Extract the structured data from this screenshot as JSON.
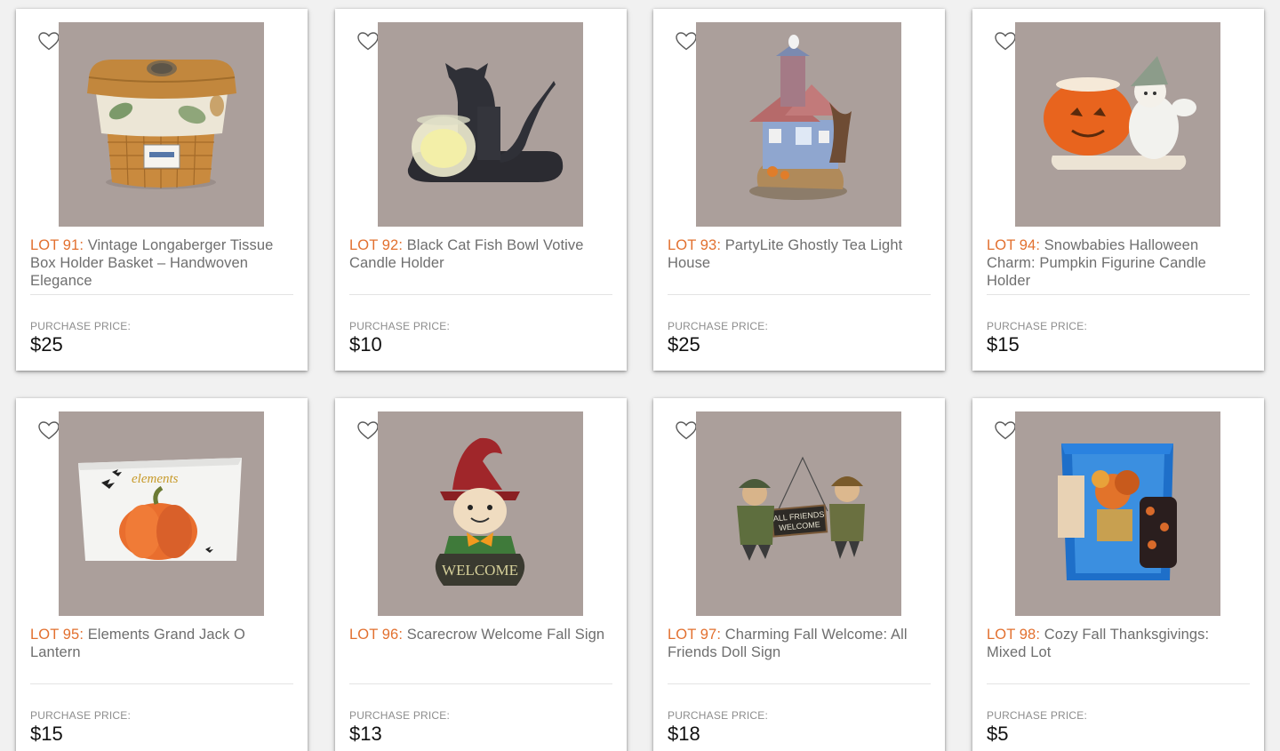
{
  "colors": {
    "lot_accent": "#e2702f",
    "title_text": "#6e6e6e",
    "image_bg": "#ab9f9b"
  },
  "lots": [
    {
      "lot_label": "LOT 91:",
      "title": "Vintage Longaberger Tissue Box Holder Basket – Handwoven Elegance",
      "price_label": "PURCHASE PRICE:",
      "price": "$25",
      "icon": "heart-outline-icon"
    },
    {
      "lot_label": "LOT 92:",
      "title": "Black Cat Fish Bowl Votive Candle Holder",
      "price_label": "PURCHASE PRICE:",
      "price": "$10",
      "icon": "heart-outline-icon"
    },
    {
      "lot_label": "LOT 93:",
      "title": "PartyLite Ghostly Tea Light House",
      "price_label": "PURCHASE PRICE:",
      "price": "$25",
      "icon": "heart-outline-icon"
    },
    {
      "lot_label": "LOT 94:",
      "title": "Snowbabies Halloween Charm: Pumpkin Figurine Candle Holder",
      "price_label": "PURCHASE PRICE:",
      "price": "$15",
      "icon": "heart-outline-icon"
    },
    {
      "lot_label": "LOT 95:",
      "title": "Elements Grand Jack O Lantern",
      "price_label": "PURCHASE PRICE:",
      "price": "$15",
      "icon": "heart-outline-icon"
    },
    {
      "lot_label": "LOT 96:",
      "title": "Scarecrow Welcome Fall Sign",
      "price_label": "PURCHASE PRICE:",
      "price": "$13",
      "icon": "heart-outline-icon"
    },
    {
      "lot_label": "LOT 97:",
      "title": "Charming Fall Welcome: All Friends Doll Sign",
      "price_label": "PURCHASE PRICE:",
      "price": "$18",
      "icon": "heart-outline-icon"
    },
    {
      "lot_label": "LOT 98:",
      "title": "Cozy Fall Thanksgivings: Mixed Lot",
      "price_label": "PURCHASE PRICE:",
      "price": "$5",
      "icon": "heart-outline-icon"
    }
  ],
  "image_text": {
    "box_brand": "elements",
    "sign_welcome": "WELCOME",
    "doll_sign_line1": "ALL FRIENDS",
    "doll_sign_line2": "WELCOME"
  }
}
